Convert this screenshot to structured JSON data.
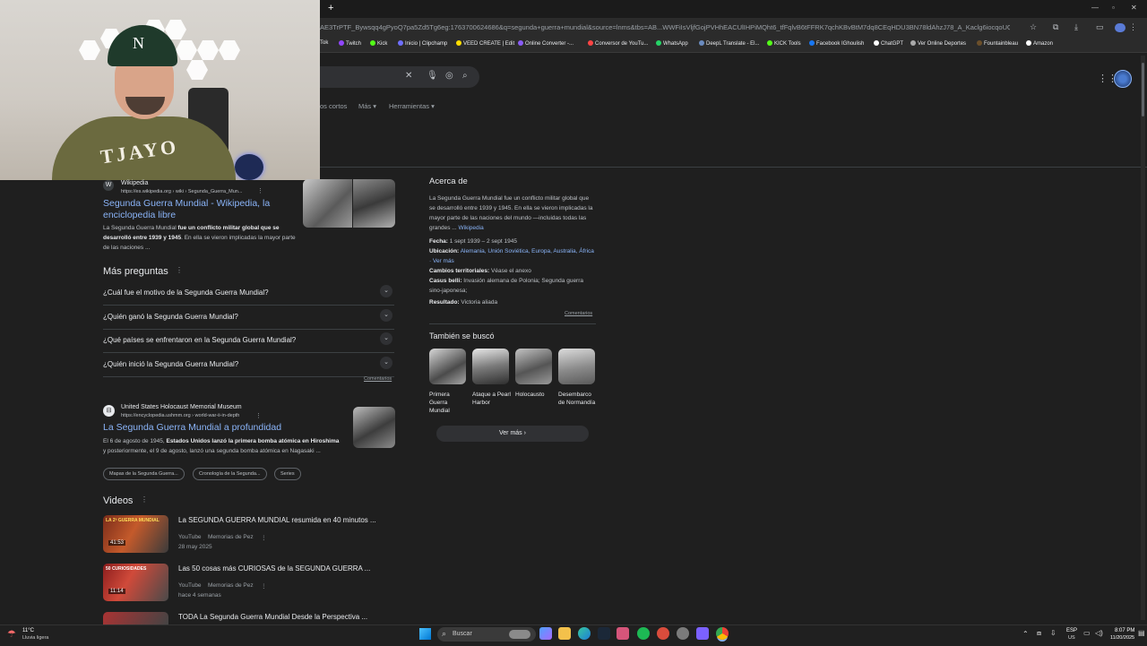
{
  "browser": {
    "url": "AE3TrPTF_Bywsqq4gPyoQ7pa5Zd5Tg6eg:1763700624686&q=segunda+guerra+mundial&source=lnms&tbs=AB...WWFiIsVljfGojPVHhEACUlIHPiMQht6_tfFqlvB6tFFRK7qchKBvBtM7dq8CEqHDU3BN78ldAhzJ78_A_Kaclg6iocqoUQ006cqwZvzdVOg1L8502_hxUf?IF...",
    "bookmarks": [
      {
        "label": "Tok",
        "color": "#ffffff"
      },
      {
        "label": "Twitch",
        "color": "#9146ff"
      },
      {
        "label": "Kick",
        "color": "#53fc18"
      },
      {
        "label": "Inicio | Clipchamp",
        "color": "#6f6fff"
      },
      {
        "label": "VEED CREATE | Edit",
        "color": "#ffdd00"
      },
      {
        "label": "Online Converter -...",
        "color": "#8a5cf6"
      },
      {
        "label": "Conversor de YouTu...",
        "color": "#ff4444"
      },
      {
        "label": "WhatsApp",
        "color": "#25d366"
      },
      {
        "label": "DeepL Translate - El...",
        "color": "#0f2b46"
      },
      {
        "label": "KICK Tools",
        "color": "#53fc18"
      },
      {
        "label": "Facebook IGhoulish",
        "color": "#1877f2"
      },
      {
        "label": "ChatGPT",
        "color": "#ffffff"
      },
      {
        "label": "Ver Online Deportes",
        "color": "#aaaaaa"
      },
      {
        "label": "Fountainbleau",
        "color": "#6b4f2a"
      },
      {
        "label": "Amazon",
        "color": "#ffffff"
      }
    ]
  },
  "search": {
    "clear_icon": "✕",
    "tabs": [
      "os cortos",
      "Más",
      "Herramientas"
    ]
  },
  "result1": {
    "site": "Wikipedia",
    "url": "https://es.wikipedia.org › wiki › Segunda_Guerra_Mun...",
    "title": "Segunda Guerra Mundial - Wikipedia, la enciclopedia libre",
    "snippet_pre": "La Segunda Guerra Mundial ",
    "snippet_bold": "fue un conflicto militar global que se desarrolló entre 1939 y 1945",
    "snippet_post": ". En ella se vieron implicadas la mayor parte de las naciones ..."
  },
  "paa": {
    "heading": "Más preguntas",
    "questions": [
      "¿Cuál fue el motivo de la Segunda Guerra Mundial?",
      "¿Quién ganó la Segunda Guerra Mundial?",
      "¿Qué países se enfrentaron en la Segunda Guerra Mundial?",
      "¿Quién inició la Segunda Guerra Mundial?"
    ],
    "feedback": "Comentarios"
  },
  "result2": {
    "site": "United States Holocaust Memorial Museum",
    "url": "https://encyclopedia.ushmm.org › world-war-ii-in-depth",
    "title": "La Segunda Guerra Mundial a profundidad",
    "snippet_pre": "El 6 de agosto de 1945, ",
    "snippet_bold1": "Estados Unidos lanzó la primera bomba atómica en Hiroshima",
    "snippet_mid": " y posteriormente, el 9 de agosto, lanzó una segunda bomba atómica en Nagasaki ...",
    "chips": [
      "Mapas de la Segunda Guerra...",
      "Cronología de la Segunda...",
      "Series"
    ]
  },
  "videos": {
    "heading": "Videos",
    "items": [
      {
        "title": "La SEGUNDA GUERRA MUNDIAL resumida en 40 minutos ...",
        "source": "YouTube",
        "channel": "Memorias de Pez",
        "date": "28 may 2025",
        "duration": "41:53"
      },
      {
        "title": "Las 50 cosas más CURIOSAS de la SEGUNDA GUERRA ...",
        "source": "YouTube",
        "channel": "Memorias de Pez",
        "date": "hace 4 semanas",
        "duration": "11:14"
      },
      {
        "title": "TODA La Segunda Guerra Mundial Desde la Perspectiva ...",
        "source": "",
        "channel": "",
        "date": "",
        "duration": ""
      }
    ]
  },
  "knowledge_panel": {
    "heading": "Acerca de",
    "description": "La Segunda Guerra Mundial fue un conflicto militar global que se desarrolló entre 1939 y 1945. En ella se vieron implicadas la mayor parte de las naciones del mundo —incluidas todas las grandes ...",
    "source_link": "Wikipedia",
    "facts": [
      {
        "label": "Fecha:",
        "value": "1 sept 1939 – 2 sept 1945"
      },
      {
        "label": "Ubicación:",
        "value": "Alemania, Unión Soviética, Europa, Australia, África · Ver más"
      },
      {
        "label": "Cambios territoriales:",
        "value": "Véase el anexo"
      },
      {
        "label": "Casus belli:",
        "value": "Invasión alemana de Polonia; Segunda guerra sino-japonesa;"
      },
      {
        "label": "Resultado:",
        "value": "Victoria aliada"
      }
    ],
    "feedback": "Comentarios",
    "also_searched_heading": "También se buscó",
    "also_searched": [
      "Primera Guerra Mundial",
      "Ataque a Pearl Harbor",
      "Holocausto",
      "Desembarco de Normandía"
    ],
    "see_more": "Ver más"
  },
  "taskbar": {
    "weather_temp": "11°C",
    "weather_desc": "Lluvia ligera",
    "search_placeholder": "Buscar",
    "lang": "ESP",
    "lang_sub": "US",
    "time": "8:07 PM",
    "date": "11/20/2025"
  }
}
